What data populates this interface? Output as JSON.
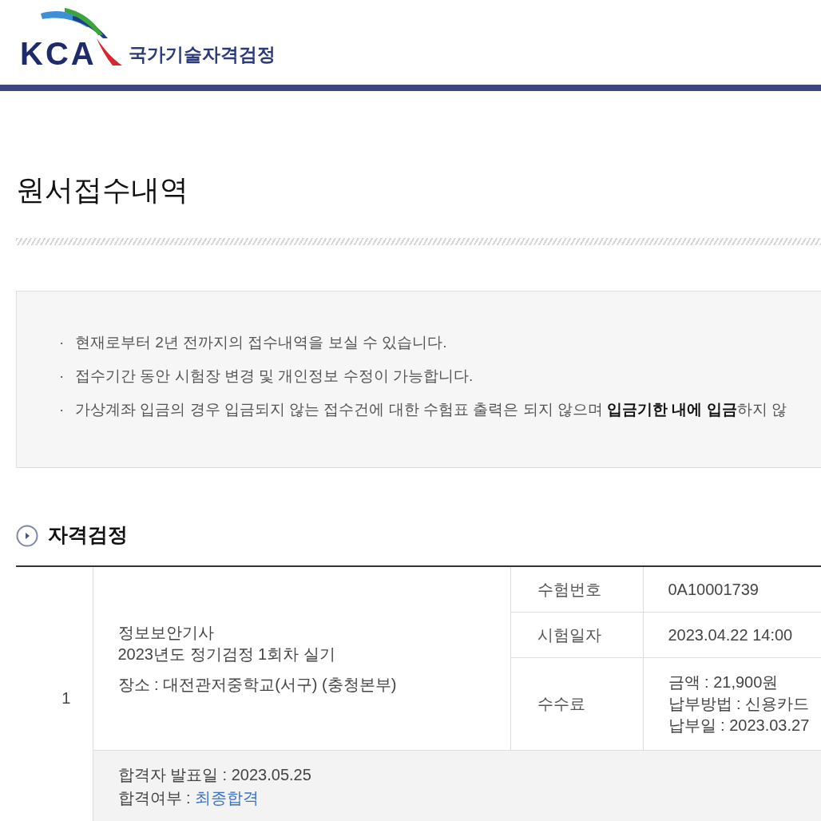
{
  "header": {
    "logo_text": "KCA",
    "site_name": "국가기술자격검정"
  },
  "page_title": "원서접수내역",
  "notices": [
    {
      "bullet": "·",
      "text": "현재로부터 2년 전까지의 접수내역을 보실 수 있습니다."
    },
    {
      "bullet": "·",
      "text": "접수기간 동안 시험장 변경 및 개인정보 수정이 가능합니다."
    },
    {
      "bullet": "·",
      "text": "가상계좌 입금의 경우 입금되지 않는 접수건에 대한 수험표 출력은 되지 않으며 **입금기한 내에 입금**하지 않"
    }
  ],
  "section": {
    "title": "자격검정"
  },
  "applications": [
    {
      "number": "1",
      "exam_name": "정보보안기사",
      "session": "2023년도 정기검정 1회차 실기",
      "venue": "장소 : 대전관저중학교(서구) (충청본부)",
      "details": [
        {
          "label": "수험번호",
          "lines": [
            "0A10001739"
          ]
        },
        {
          "label": "시험일자",
          "lines": [
            "2023.04.22 14:00"
          ]
        },
        {
          "label": "수수료",
          "lines": [
            "금액 : 21,900원",
            "납부방법 : 신용카드",
            "납부일 : 2023.03.27"
          ]
        }
      ],
      "announcement": "합격자 발표일 : 2023.05.25",
      "result_label": "합격여부 :",
      "result": "최종합격"
    }
  ]
}
